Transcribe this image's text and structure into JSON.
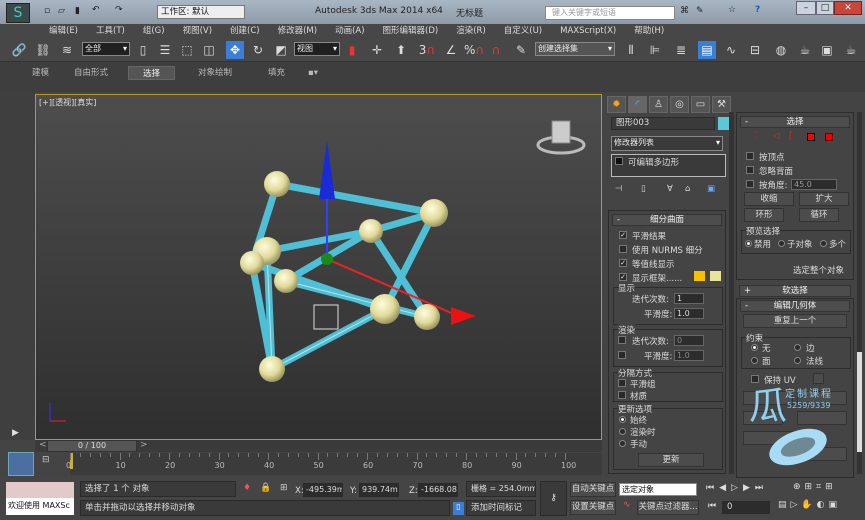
{
  "title": {
    "app": "Autodesk 3ds Max  2014 x64",
    "doc": "无标题",
    "workspace": "工作区: 默认",
    "search_placeholder": "键入关键字或短语"
  },
  "menu": [
    "编辑(E)",
    "工具(T)",
    "组(G)",
    "视图(V)",
    "创建(C)",
    "修改器(M)",
    "动画(A)",
    "图形编辑器(D)",
    "渲染(R)",
    "自定义(U)",
    "MAXScript(X)",
    "帮助(H)"
  ],
  "toolbar": {
    "filter": "全部",
    "coord": "视图",
    "selection_set": "创建选择集",
    "snap_3": "3",
    "snap_pct": "%"
  },
  "ribbon": {
    "tabs": [
      "建模",
      "自由形式",
      "选择",
      "对象绘制",
      "填充"
    ],
    "active": "选择"
  },
  "viewport": {
    "label": "[+][透视][真实]"
  },
  "cmd": {
    "object_name": "图形003",
    "object_color": "#5bc8d8",
    "modifier_list": "修改器列表",
    "stack_item": "可编辑多边形",
    "subdiv": {
      "title": "细分曲面",
      "smooth_result": "平滑结果",
      "nurms": "使用 NURMS 细分",
      "isoline": "等值线显示",
      "show_cage": "显示框架......",
      "display": "显示",
      "iterations": "迭代次数:",
      "iter_val": "1",
      "smoothness": "平滑度:",
      "smooth_val": "1.0",
      "render": "渲染",
      "r_iter_val": "0",
      "r_smooth_val": "1.0",
      "sep": "分隔方式",
      "smooth_groups": "平滑组",
      "materials": "材质",
      "update": "更新选项",
      "always": "始终",
      "on_render": "渲染时",
      "manual": "手动",
      "update_btn": "更新"
    },
    "select": {
      "title": "选择",
      "by_vertex": "按顶点",
      "ignore_back": "忽略背面",
      "by_angle": "按角度:",
      "angle_val": "45.0",
      "shrink": "收缩",
      "grow": "扩大",
      "ring": "环形",
      "loop": "循环",
      "preview": "预览选择",
      "disabled": "禁用",
      "subobj": "子对象",
      "multi": "多个",
      "select_all": "选定整个对象"
    },
    "soft": "软选择",
    "edit": {
      "title": "编辑几何体",
      "repeat": "重复上一个",
      "constraints": "约束",
      "none": "无",
      "edge": "边",
      "face": "面",
      "normal": "法线",
      "preserve_uv": "保持 UV"
    },
    "watermark": "定制课程",
    "watermark_num": "5259/9339"
  },
  "timeline": {
    "frame": "0 / 100",
    "ticks": [
      "0",
      "10",
      "20",
      "30",
      "40",
      "50",
      "60",
      "70",
      "80",
      "90",
      "100"
    ]
  },
  "status": {
    "welcome": "欢迎使用 MAXSc",
    "selected": "选择了 1 个 对象",
    "hint": "单击并拖动以选择并移动对象",
    "x_label": "X:",
    "x": "-495.39mm",
    "y_label": "Y:",
    "y": "939.74mm",
    "z_label": "Z:",
    "z": "-1668.085",
    "grid": "栅格 = 254.0mm",
    "add_tag": "添加时间标记",
    "auto_key": "自动关键点",
    "set_key": "设置关键点",
    "key_mode": "选定对象",
    "key_filter": "关键点过滤器...",
    "frame_val": "0"
  }
}
